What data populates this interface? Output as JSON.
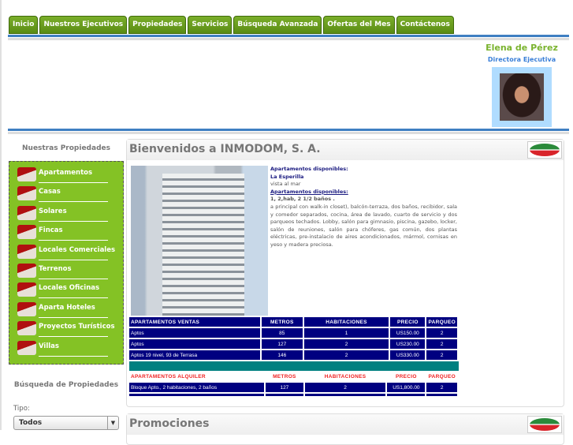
{
  "nav": [
    "Inicio",
    "Nuestros Ejecutivos",
    "Propiedades",
    "Servicios",
    "Búsqueda Avanzada",
    "Ofertas del Mes",
    "Contáctenos"
  ],
  "executive": {
    "name": "Elena de Pérez",
    "title": "Directora Ejecutiva"
  },
  "sidebar": {
    "title": "Nuestras Propiedades",
    "items": [
      "Apartamentos",
      "Casas",
      "Solares",
      "Fincas",
      "Locales Comerciales",
      "Terrenos",
      "Locales Oficinas",
      "Aparta Hoteles",
      "Proyectos Turísticos",
      "Villas"
    ],
    "search_title": "Búsqueda de Propiedades",
    "tipo_label": "Tipo:",
    "tipo_value": "Todos"
  },
  "main": {
    "title": "Bienvenidos a INMODOM, S. A.",
    "desc": {
      "l1": "Apartamentos disponibles:",
      "l2": "La Esperilla",
      "l3": "vista al mar",
      "l4": "Apartamentos disponibles:",
      "l5": "1, 2,hab, 2 1/2 baños .",
      "body": "a principal con walk-in closet), balcón-terraza, dos baños, recibidor, sala y comedor separados, cocina, área de lavado, cuarto de servicio y dos parqueos techados. Lobby, salón para gimnasio, piscina, gazebo, locker, salón de reuniones, salón para chóferes, gas común, dos plantas eléctricas, pre-instalacio de aires acondicionados, mármol, cornisas en yeso y madera preciosa."
    },
    "sales": {
      "headers": [
        "APARTAMENTOS  VENTAS",
        "METROS",
        "HABITACIONES",
        "PRECIO",
        "PARQUEO"
      ],
      "rows": [
        [
          "Aptos",
          "85",
          "1",
          "US150.00",
          "2"
        ],
        [
          "Aptos",
          "127",
          "2",
          "US230.00",
          "2"
        ],
        [
          "Aptos 19 nivel, 93 de Terrasa",
          "146",
          "2",
          "US330.00",
          "2"
        ]
      ]
    },
    "rent": {
      "headers": [
        "APARTAMENTOS ALQUILER",
        "METROS",
        "HABITACIONES",
        "PRECIO",
        "PARQUEO"
      ],
      "rows": [
        [
          "Bloque  Apto., 2 habitaciones, 2 baños",
          "127",
          "2",
          "US1,800.00",
          "2"
        ]
      ]
    }
  },
  "promo": {
    "title": "Promociones"
  }
}
